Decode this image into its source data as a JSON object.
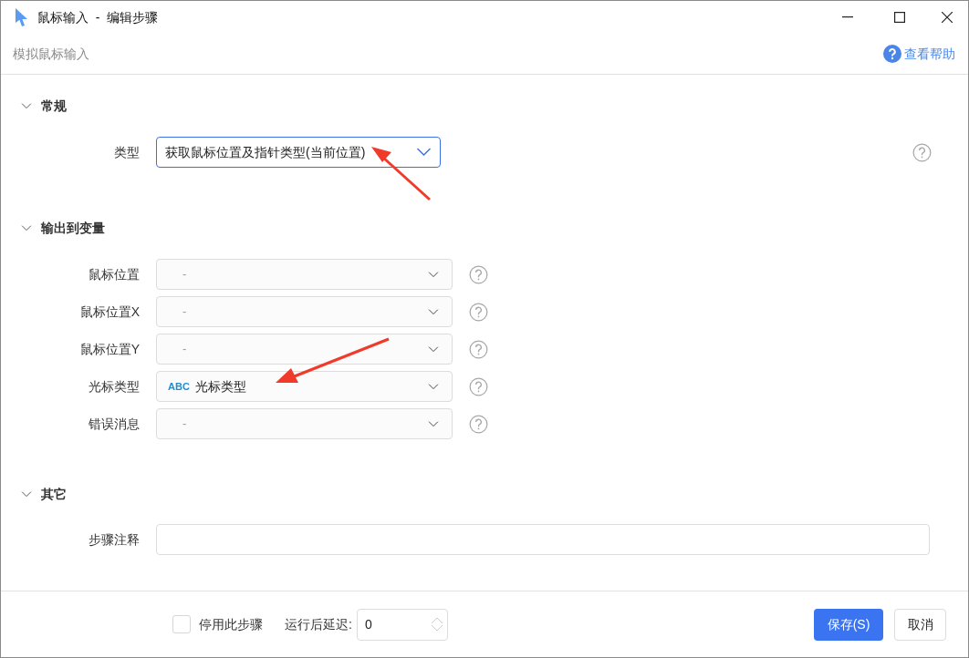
{
  "window": {
    "title": "鼠标输入  -  编辑步骤",
    "subtitle": "模拟鼠标输入",
    "help_link": "查看帮助"
  },
  "sections": [
    {
      "title": "常规",
      "expanded": true,
      "fields": [
        {
          "kind": "select",
          "label": "类型",
          "value": "获取鼠标位置及指针类型(当前位置)"
        }
      ]
    },
    {
      "title": "输出到变量",
      "expanded": true,
      "fields": [
        {
          "kind": "variable",
          "label": "鼠标位置",
          "placeholder": "-"
        },
        {
          "kind": "variable",
          "label": "鼠标位置X",
          "placeholder": "-"
        },
        {
          "kind": "variable",
          "label": "鼠标位置Y",
          "placeholder": "-"
        },
        {
          "kind": "variable",
          "label": "光标类型",
          "badge": "ABC",
          "value": "光标类型"
        },
        {
          "kind": "variable",
          "label": "错误消息",
          "placeholder": "-"
        }
      ]
    },
    {
      "title": "其它",
      "expanded": true,
      "fields": [
        {
          "kind": "text",
          "label": "步骤注释"
        }
      ]
    }
  ],
  "footer": {
    "disable_step": {
      "label": "停用此步骤",
      "checked": false
    },
    "delay": {
      "label": "运行后延迟:",
      "value": "0"
    },
    "buttons": [
      {
        "label": "保存(S)",
        "kind": "primary"
      },
      {
        "label": "取消",
        "kind": "secondary"
      }
    ]
  }
}
